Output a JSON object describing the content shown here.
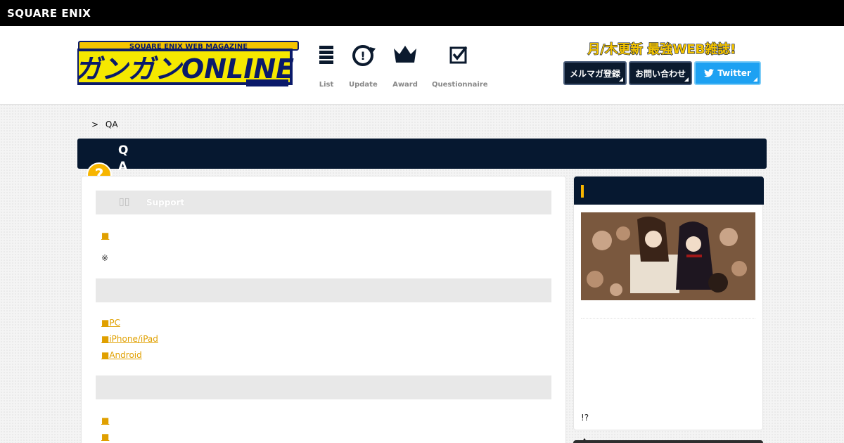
{
  "topbar": {
    "brand": "SQUARE ENIX"
  },
  "header": {
    "logo_text": "ガンガンONLINE",
    "logo_subtext": "SQUARE ENIX WEB MAGAZINE",
    "nav": [
      {
        "label": "List",
        "icon": "list-icon"
      },
      {
        "label": "Update",
        "icon": "update-icon"
      },
      {
        "label": "Award",
        "icon": "crown-icon"
      },
      {
        "label": "Questionnaire",
        "icon": "checkbox-icon"
      }
    ],
    "tagline": "月/木更新 最強WEB雑誌!",
    "buttons": {
      "newsletter": "メルマガ登録",
      "contact": "お問い合わせ",
      "twitter": "Twitter"
    }
  },
  "breadcrumb": {
    "separator": ">",
    "current": "QA"
  },
  "title": {
    "line1": "Q",
    "line2": "A",
    "badge": "?"
  },
  "main": {
    "section1": {
      "label": "Support"
    },
    "link1": "■",
    "note": "※",
    "links2": [
      "■PC",
      "■iPhone/iPad",
      "■Android"
    ],
    "links3": [
      "■",
      "■"
    ]
  },
  "sidebar": {
    "text": "!?"
  },
  "colors": {
    "navy": "#061830",
    "accent": "#f7b500",
    "link": "#e0a000",
    "twitter": "#1da1f2"
  }
}
